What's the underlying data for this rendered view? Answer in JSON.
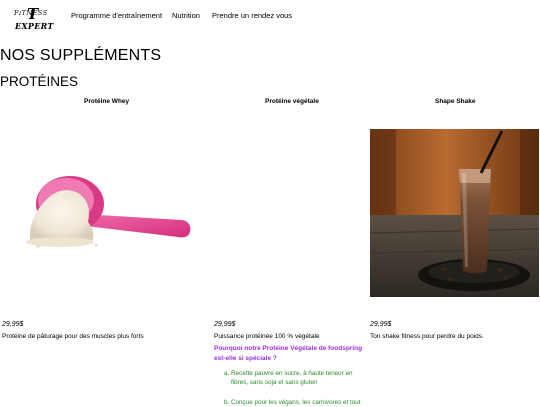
{
  "logo": {
    "top": "FɪTNESS",
    "initial": "T",
    "bottom": "EXPERT"
  },
  "nav": {
    "items": [
      "Programme d'entraînement",
      "Nutrition",
      "Prendre un rendez vous"
    ]
  },
  "page_title": "NOS SUPPLÉMENTS",
  "section_title": "PROTÉINES",
  "products": [
    {
      "name": "Protéine Whey",
      "price": "29,99$",
      "description": "Protéine de pâturage pour des muscles plus forts"
    },
    {
      "name": "Protéine végétale",
      "price": "29,99$",
      "description": "Puissance protéinée 100 % végétale",
      "question": "Pourquoi notre Protéine Végétale de foodspring est-elle si spéciale ?",
      "reasons": [
        {
          "marker": "a.",
          "text": "Recette pauvre en sucre, à haute teneur en fibres, sans soja et sans gluten"
        },
        {
          "marker": "b.",
          "text": "Conçue pour les végans, les carnivores et tout"
        }
      ]
    },
    {
      "name": "Shape Shake",
      "price": "29,99$",
      "description": "Ton shake fitness pour perdre du poids."
    }
  ],
  "colors": {
    "question": "#9b30d9",
    "reasons": "#2a8a2a",
    "scoop": "#e0448f"
  },
  "icons": {
    "logo": "fitness-expert-logo"
  }
}
